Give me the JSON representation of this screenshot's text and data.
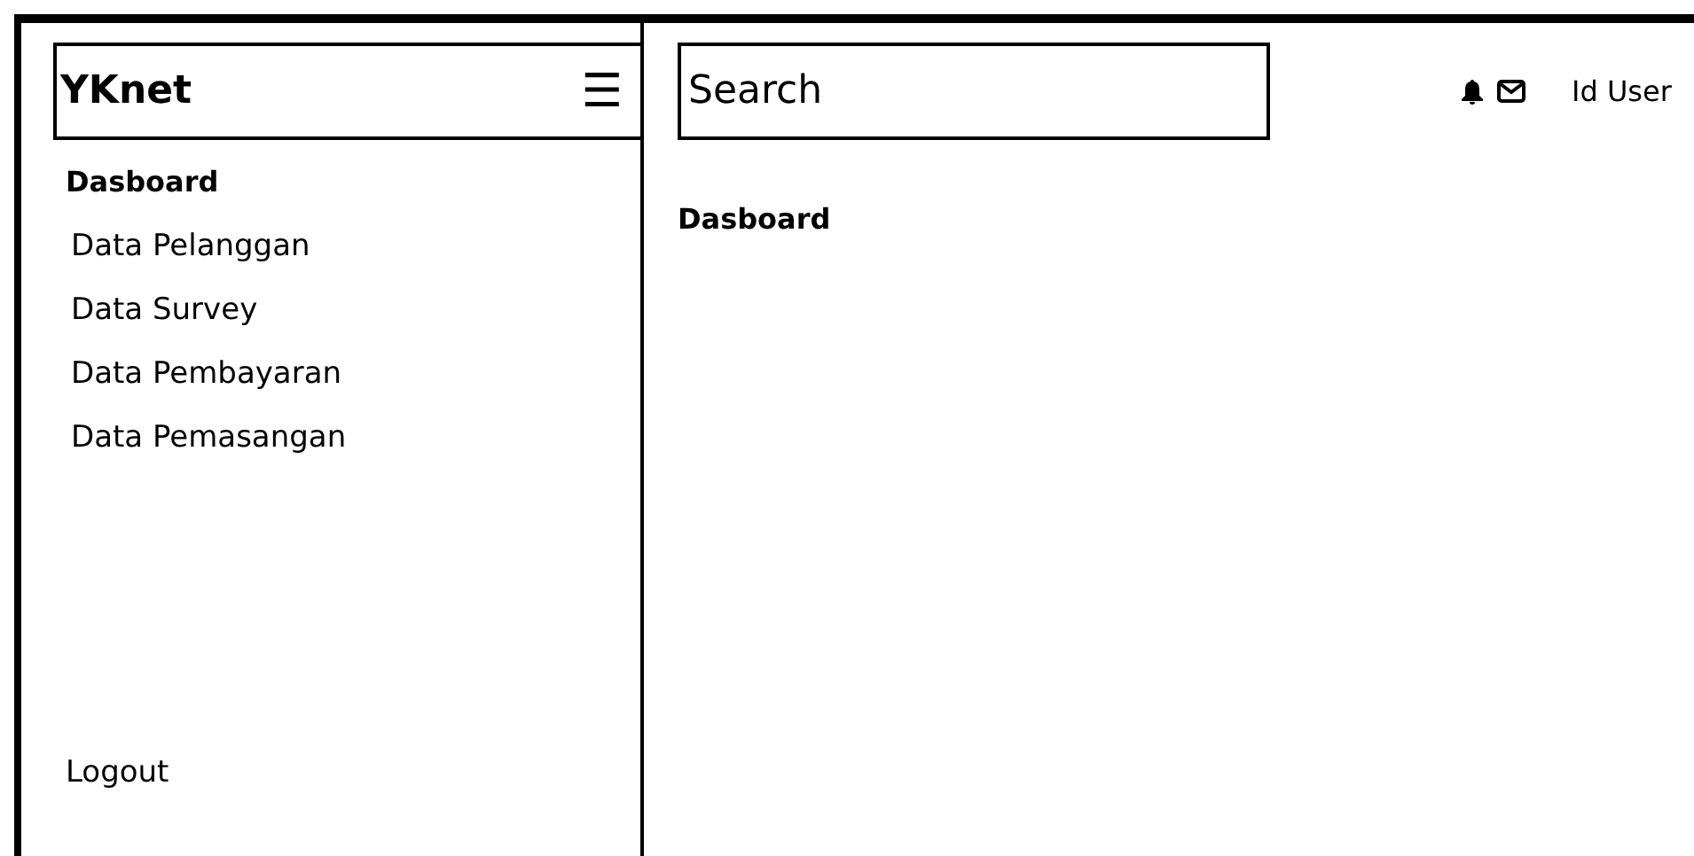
{
  "sidebar": {
    "brand": "YKnet",
    "menu_icon": "☰",
    "items": [
      {
        "label": "Dasboard",
        "selected": true
      },
      {
        "label": "Data Pelanggan",
        "selected": false
      },
      {
        "label": "Data Survey",
        "selected": false
      },
      {
        "label": "Data Pembayaran",
        "selected": false
      },
      {
        "label": "Data Pemasangan",
        "selected": false
      }
    ],
    "logout": "Logout"
  },
  "header": {
    "search": {
      "placeholder": "Search"
    },
    "user": "Id User"
  },
  "content": {
    "title": "Dasboard"
  }
}
